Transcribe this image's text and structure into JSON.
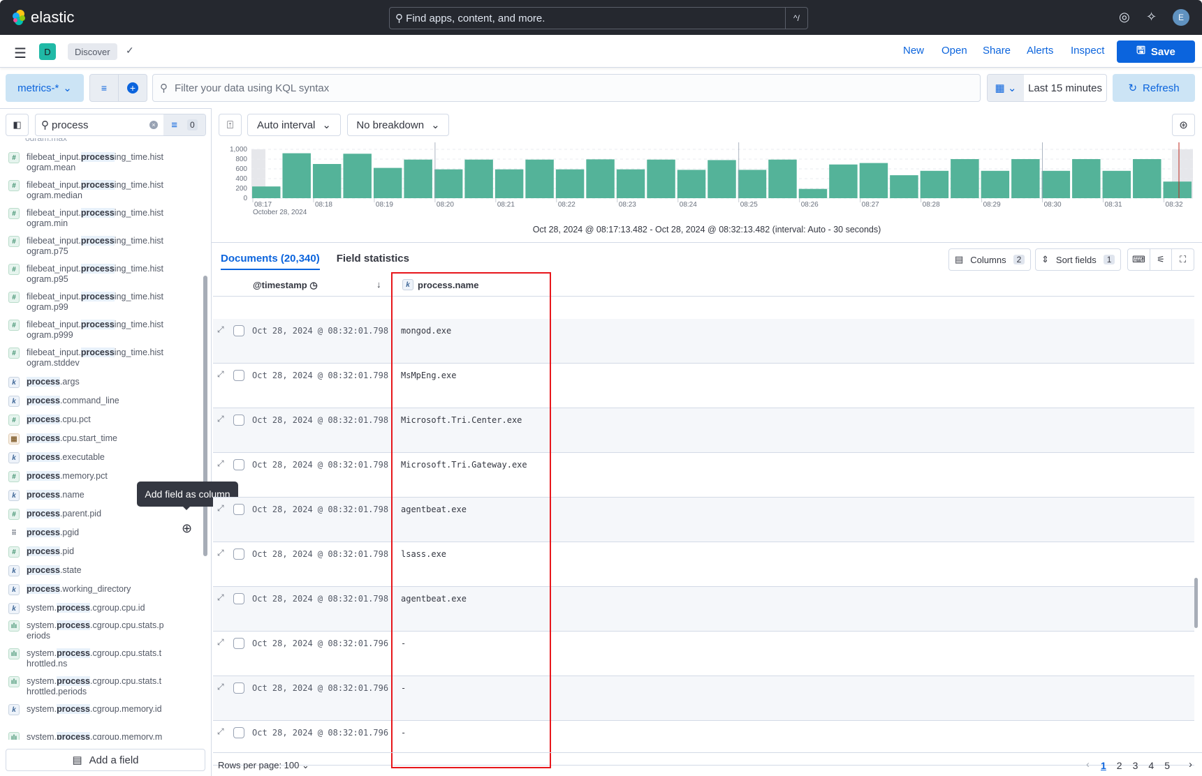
{
  "header": {
    "brand": "elastic",
    "search_placeholder": "Find apps, content, and more.",
    "shortcut": "^/",
    "avatar": "E",
    "icons": [
      "help-icon",
      "news-feed-icon"
    ]
  },
  "app_bar": {
    "space": "D",
    "breadcrumb": "Discover",
    "nav": [
      "New",
      "Open",
      "Share",
      "Alerts",
      "Inspect"
    ],
    "save": "Save"
  },
  "query_bar": {
    "data_view": "metrics-*",
    "placeholder": "Filter your data using KQL syntax",
    "time": "Last 15 minutes",
    "refresh": "Refresh"
  },
  "sidebar": {
    "search": "process",
    "filter_count": "0",
    "fields": [
      {
        "type": "num",
        "pre": "filebeat_input.",
        "hl": "process",
        "post": "ing_time.histogram.mean"
      },
      {
        "type": "num",
        "pre": "filebeat_input.",
        "hl": "process",
        "post": "ing_time.histogram.median"
      },
      {
        "type": "num",
        "pre": "filebeat_input.",
        "hl": "process",
        "post": "ing_time.histogram.min"
      },
      {
        "type": "num",
        "pre": "filebeat_input.",
        "hl": "process",
        "post": "ing_time.histogram.p75"
      },
      {
        "type": "num",
        "pre": "filebeat_input.",
        "hl": "process",
        "post": "ing_time.histogram.p95"
      },
      {
        "type": "num",
        "pre": "filebeat_input.",
        "hl": "process",
        "post": "ing_time.histogram.p99"
      },
      {
        "type": "num",
        "pre": "filebeat_input.",
        "hl": "process",
        "post": "ing_time.histogram.p999"
      },
      {
        "type": "num",
        "pre": "filebeat_input.",
        "hl": "process",
        "post": "ing_time.histogram.stddev"
      },
      {
        "type": "kw",
        "pre": "",
        "hl": "process",
        "post": ".args"
      },
      {
        "type": "kw",
        "pre": "",
        "hl": "process",
        "post": ".command_line"
      },
      {
        "type": "num",
        "pre": "",
        "hl": "process",
        "post": ".cpu.pct"
      },
      {
        "type": "date",
        "pre": "",
        "hl": "process",
        "post": ".cpu.start_time"
      },
      {
        "type": "kw",
        "pre": "",
        "hl": "process",
        "post": ".executable"
      },
      {
        "type": "num",
        "pre": "",
        "hl": "process",
        "post": ".memory.pct"
      },
      {
        "type": "kw",
        "pre": "",
        "hl": "process",
        "post": ".name"
      },
      {
        "type": "num",
        "pre": "",
        "hl": "process",
        "post": ".parent.pid"
      },
      {
        "type": "drag",
        "pre": "",
        "hl": "process",
        "post": ".pgid"
      },
      {
        "type": "num",
        "pre": "",
        "hl": "process",
        "post": ".pid"
      },
      {
        "type": "kw",
        "pre": "",
        "hl": "process",
        "post": ".state"
      },
      {
        "type": "kw",
        "pre": "",
        "hl": "process",
        "post": ".working_directory"
      },
      {
        "type": "kw",
        "pre": "system.",
        "hl": "process",
        "post": ".cgroup.cpu.id"
      },
      {
        "type": "hist",
        "pre": "system.",
        "hl": "process",
        "post": ".cgroup.cpu.stats.periods"
      },
      {
        "type": "hist",
        "pre": "system.",
        "hl": "process",
        "post": ".cgroup.cpu.stats.throttled.ns"
      },
      {
        "type": "hist",
        "pre": "system.",
        "hl": "process",
        "post": ".cgroup.cpu.stats.throttled.periods"
      },
      {
        "type": "kw",
        "pre": "system.",
        "hl": "process",
        "post": ".cgroup.memory.id"
      },
      {
        "type": "hist",
        "pre": "system.",
        "hl": "process",
        "post": ".cgroup.memory.mem.usage.bytes"
      }
    ],
    "tooltip": "Add field as column",
    "add_field": "Add a field"
  },
  "chart_toolbar": {
    "interval": "Auto interval",
    "breakdown": "No breakdown"
  },
  "chart_data": {
    "type": "bar",
    "y_ticks": [
      "1,000",
      "800",
      "600",
      "400",
      "200",
      "0"
    ],
    "ylim": [
      0,
      1000
    ],
    "x_ticks": [
      "08:17",
      "08:18",
      "08:19",
      "08:20",
      "08:21",
      "08:22",
      "08:23",
      "08:24",
      "08:25",
      "08:26",
      "08:27",
      "08:28",
      "08:29",
      "08:30",
      "08:31",
      "08:32"
    ],
    "x_sublabel": "October 28, 2024",
    "values": [
      240,
      920,
      700,
      910,
      620,
      790,
      590,
      790,
      590,
      790,
      590,
      795,
      590,
      790,
      580,
      780,
      580,
      790,
      190,
      690,
      720,
      470,
      560,
      800,
      560,
      800,
      560,
      800,
      560,
      800,
      340
    ],
    "color": "#54b399",
    "grid": true
  },
  "time_range": "Oct 28, 2024 @ 08:17:13.482 - Oct 28, 2024 @ 08:32:13.482 (interval: Auto - 30 seconds)",
  "tabs": [
    "Documents (20,340)",
    "Field statistics"
  ],
  "grid_toolbar": {
    "columns": "Columns",
    "columns_count": "2",
    "sort": "Sort fields",
    "sort_count": "1"
  },
  "table": {
    "headers": [
      "@timestamp",
      "process.name"
    ],
    "rows": [
      {
        "ts": "Oct 28, 2024 @ 08:32:01.798",
        "name": "mongod.exe"
      },
      {
        "ts": "Oct 28, 2024 @ 08:32:01.798",
        "name": "MsMpEng.exe"
      },
      {
        "ts": "Oct 28, 2024 @ 08:32:01.798",
        "name": "Microsoft.Tri.Center.exe"
      },
      {
        "ts": "Oct 28, 2024 @ 08:32:01.798",
        "name": "Microsoft.Tri.Gateway.exe"
      },
      {
        "ts": "Oct 28, 2024 @ 08:32:01.798",
        "name": "agentbeat.exe"
      },
      {
        "ts": "Oct 28, 2024 @ 08:32:01.798",
        "name": "lsass.exe"
      },
      {
        "ts": "Oct 28, 2024 @ 08:32:01.798",
        "name": "agentbeat.exe"
      },
      {
        "ts": "Oct 28, 2024 @ 08:32:01.796",
        "name": " -"
      },
      {
        "ts": "Oct 28, 2024 @ 08:32:01.796",
        "name": " -"
      },
      {
        "ts": "Oct 28, 2024 @ 08:32:01.796",
        "name": " -"
      }
    ]
  },
  "footer": {
    "rows_per_page": "Rows per page: 100",
    "pages": [
      "1",
      "2",
      "3",
      "4",
      "5"
    ],
    "current_page": "1"
  }
}
